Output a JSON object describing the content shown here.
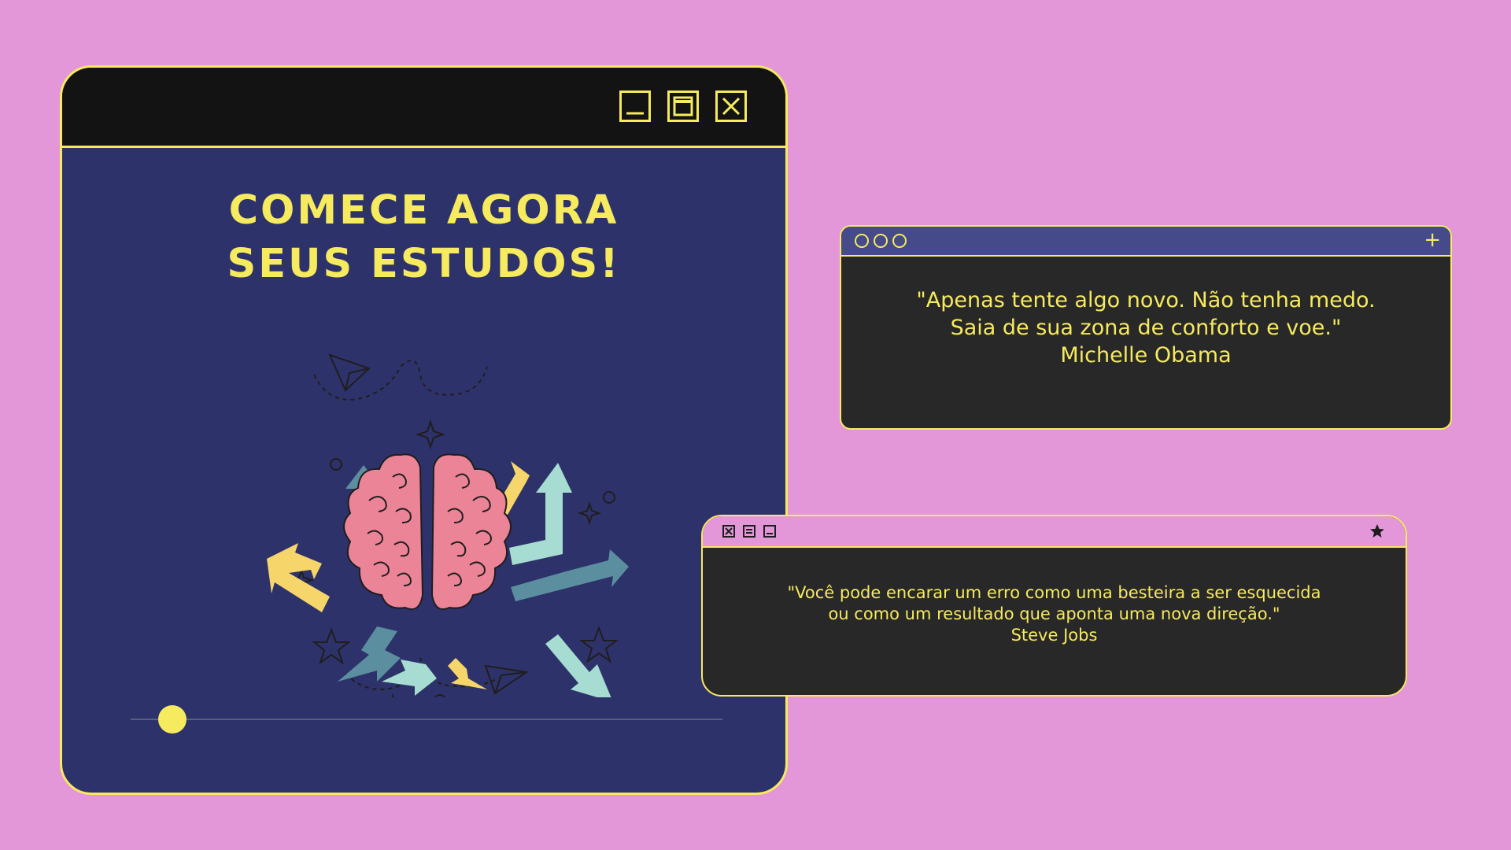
{
  "colors": {
    "background": "#e497d8",
    "main_window": "#2e326a",
    "titlebar": "#131313",
    "accent": "#f6ea5f",
    "quote_panel": "#282828",
    "quote1_bar": "#444a8a",
    "brain": "#ec8497"
  },
  "main_window": {
    "headline_line1": "COMECE AGORA",
    "headline_line2": "SEUS ESTUDOS!",
    "controls": [
      "minimize-icon",
      "maximize-icon",
      "close-icon"
    ],
    "progress": 0.07
  },
  "quote1": {
    "line1": "\"Apenas tente algo novo. Não tenha medo.",
    "line2": "Saia de sua zona de conforto e voe.\"",
    "author": "Michelle Obama",
    "icons": [
      "circle-icon",
      "circle-icon",
      "circle-icon",
      "plus-icon"
    ]
  },
  "quote2": {
    "line1": "\"Você pode encarar um erro como uma besteira a ser esquecida",
    "line2": "ou como um resultado que aponta uma nova direção.\"",
    "author": "Steve Jobs",
    "icons": [
      "close-icon",
      "maximize-icon",
      "minimize-icon",
      "star-icon"
    ]
  }
}
